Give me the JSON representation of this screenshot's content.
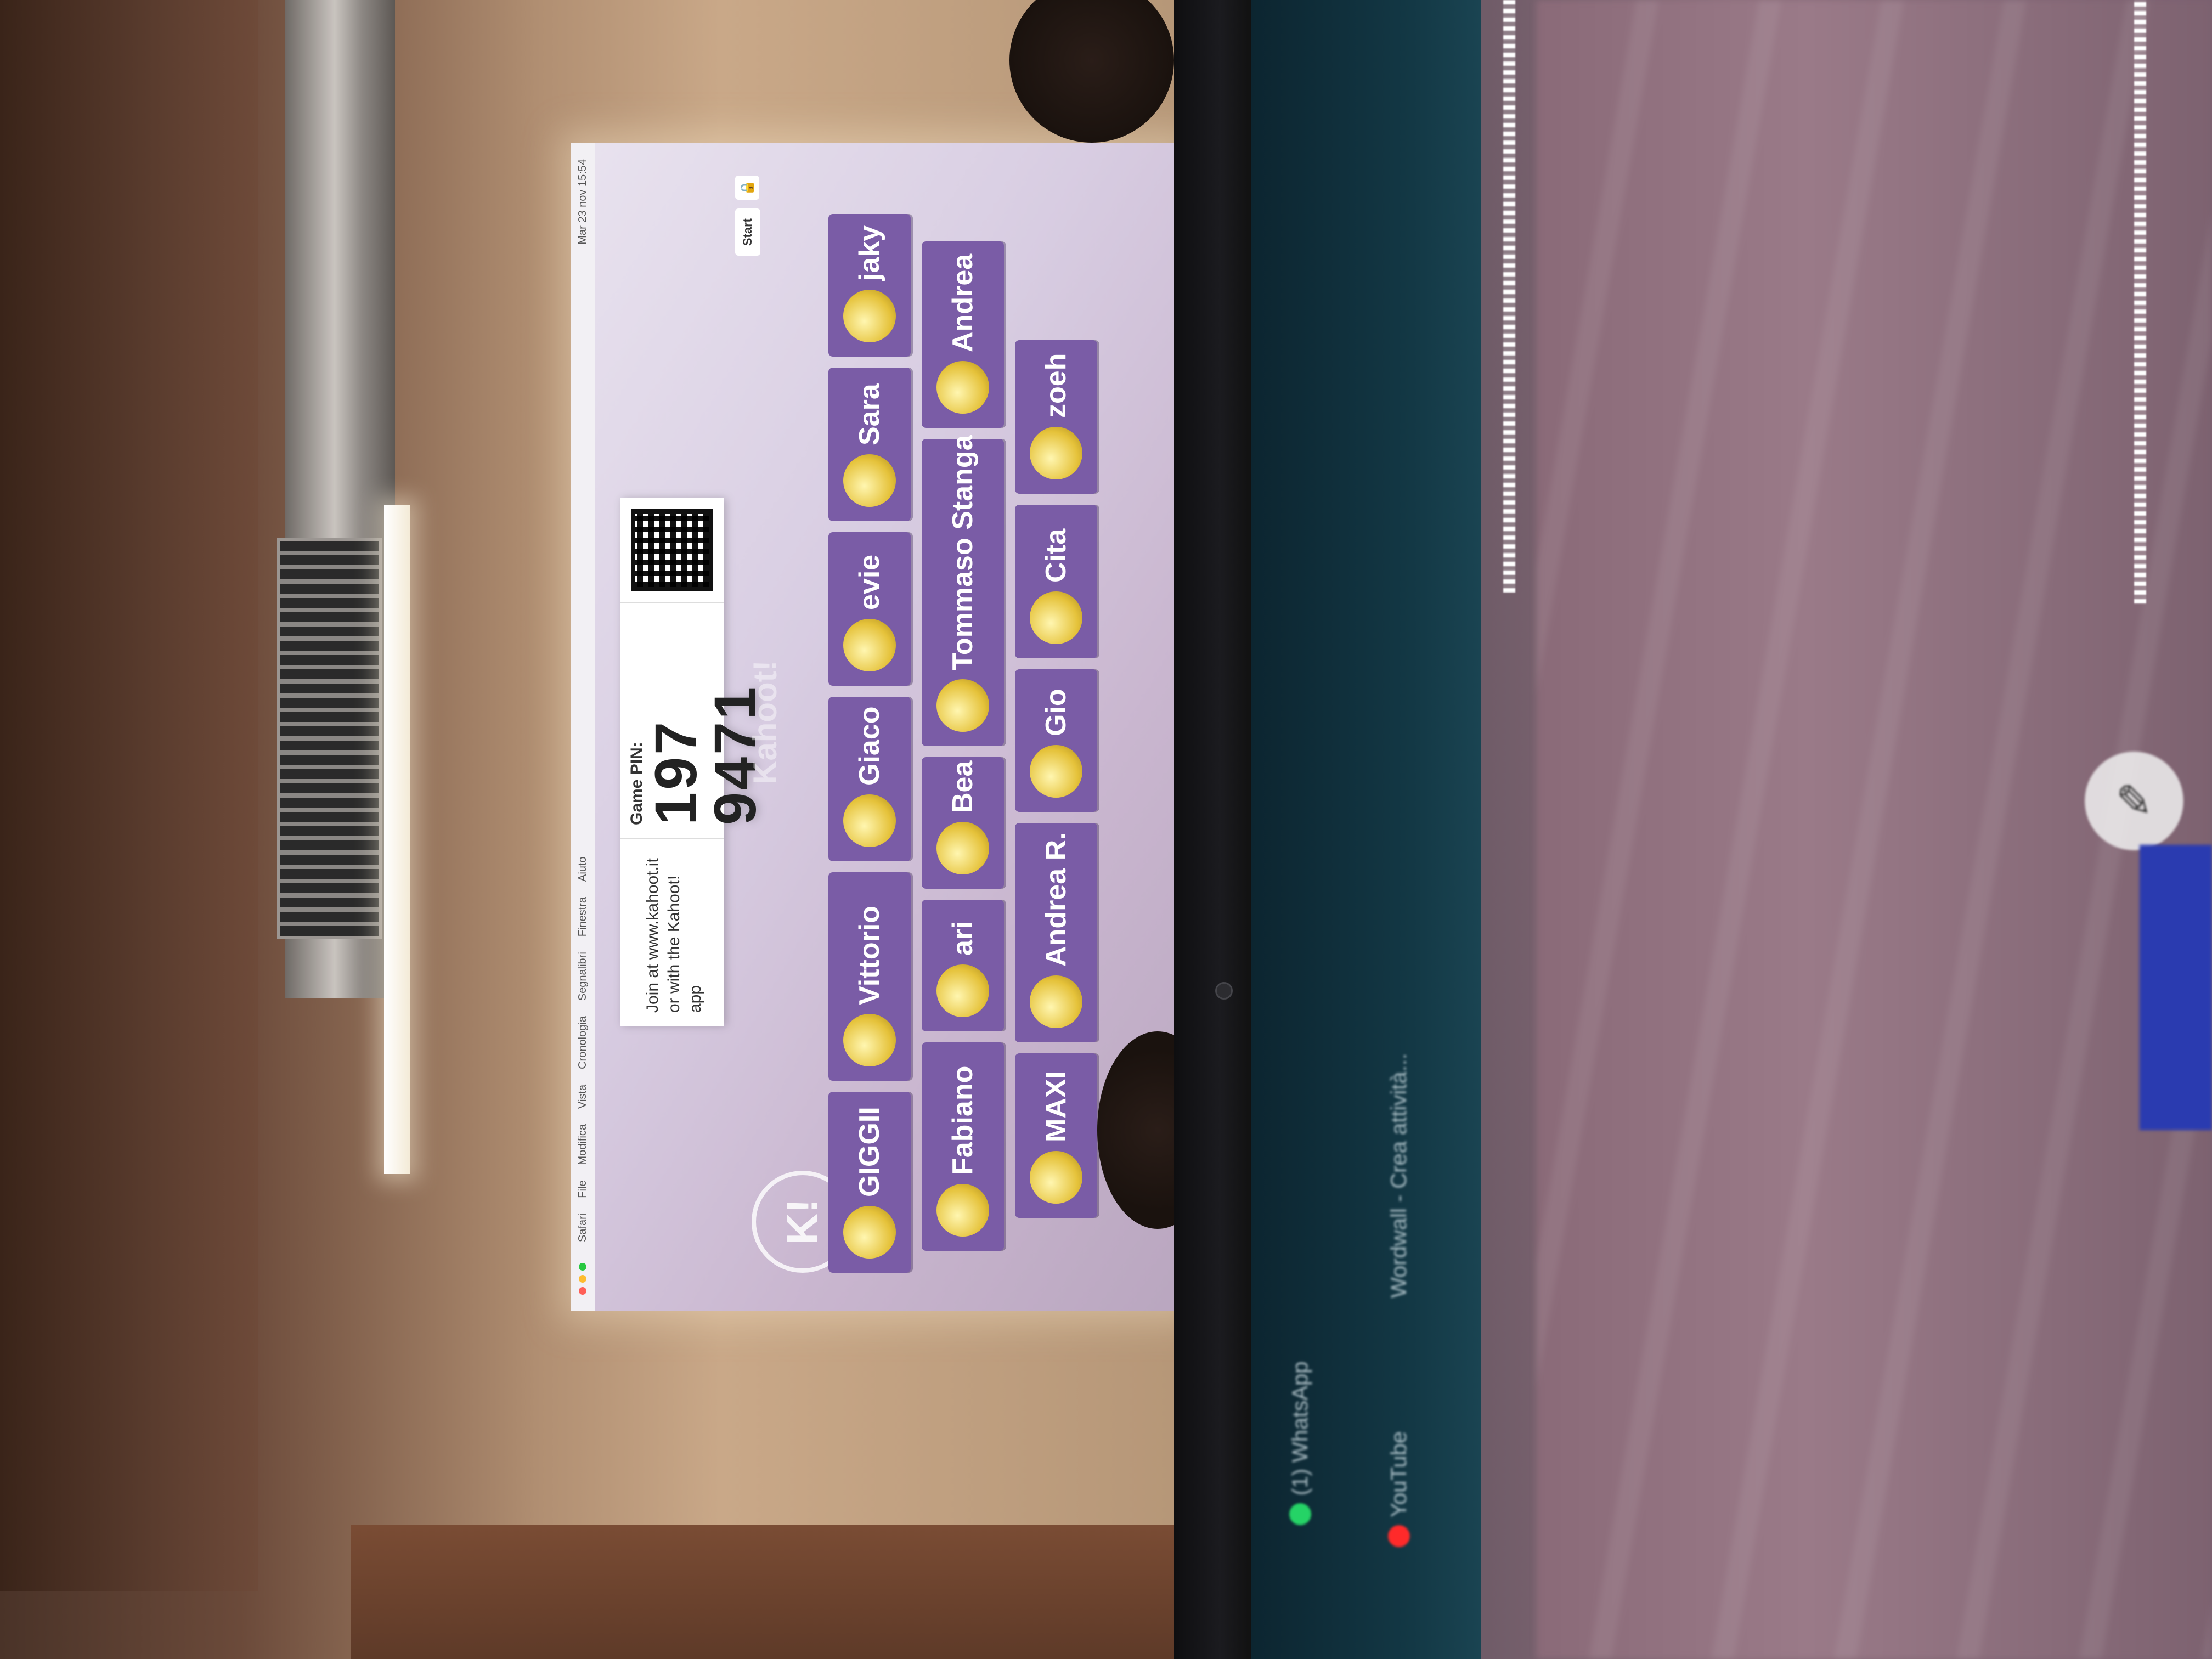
{
  "projected_lobby": {
    "menubar": {
      "items": [
        "Safari",
        "File",
        "Modifica",
        "Vista",
        "Cronologia",
        "Segnalibri",
        "Finestra",
        "Aiuto"
      ],
      "clock": "Mar 23 nov 15:54"
    },
    "join": {
      "line1": "Join at www.kahoot.it",
      "line2": "or with the Kahoot! app"
    },
    "pin": {
      "label": "Game PIN:",
      "value": "197 9471"
    },
    "watermark": "Kahoot!",
    "start_label": "Start",
    "lock_icon": "lock-icon",
    "badge_letter": "K!",
    "players": [
      "GIGGII",
      "Vittorio",
      "Giaco",
      "evie",
      "Sara",
      "jaky",
      "Fabiano",
      "ari",
      "Bea",
      "Tommaso Stanga",
      "Andrea",
      "MAXI",
      "Andrea R.",
      "Gio",
      "Cita",
      "zoeh"
    ]
  },
  "laptop": {
    "tabs": [
      "(1) WhatsApp",
      "YouTube",
      "Wordwall - Crea attività..."
    ]
  },
  "colors": {
    "player_tile": "#7a5ca6",
    "projection_bg": "#d8cde2",
    "laptop_sidebar": "#133845"
  }
}
